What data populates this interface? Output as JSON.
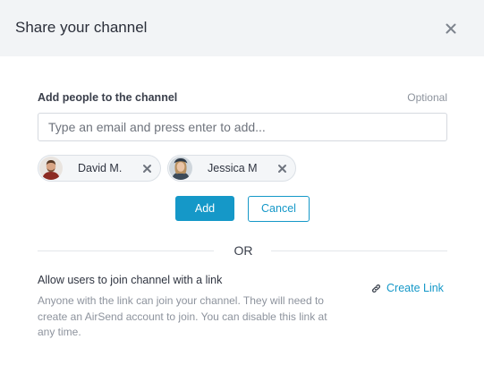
{
  "dialog": {
    "title": "Share your channel",
    "close_icon": "close-icon"
  },
  "invite": {
    "label": "Add people to the channel",
    "optional": "Optional",
    "email_placeholder": "Type an email and press enter to add...",
    "email_value": "",
    "people": [
      {
        "name": "David M.",
        "avatar_icon": "avatar-david",
        "remove_icon": "close-icon"
      },
      {
        "name": "Jessica M",
        "avatar_icon": "avatar-jessica",
        "remove_icon": "close-icon"
      }
    ],
    "add_label": "Add",
    "cancel_label": "Cancel"
  },
  "separator": "OR",
  "link_share": {
    "heading": "Allow users to join channel with a link",
    "description": "Anyone with the link can join your channel. They will need to create an AirSend account to join. You can disable this link at any time.",
    "create_label": "Create Link",
    "create_icon": "link-icon"
  },
  "colors": {
    "accent": "#1598c8",
    "header_bg": "#f2f4f6",
    "muted_text": "#8d939d"
  }
}
